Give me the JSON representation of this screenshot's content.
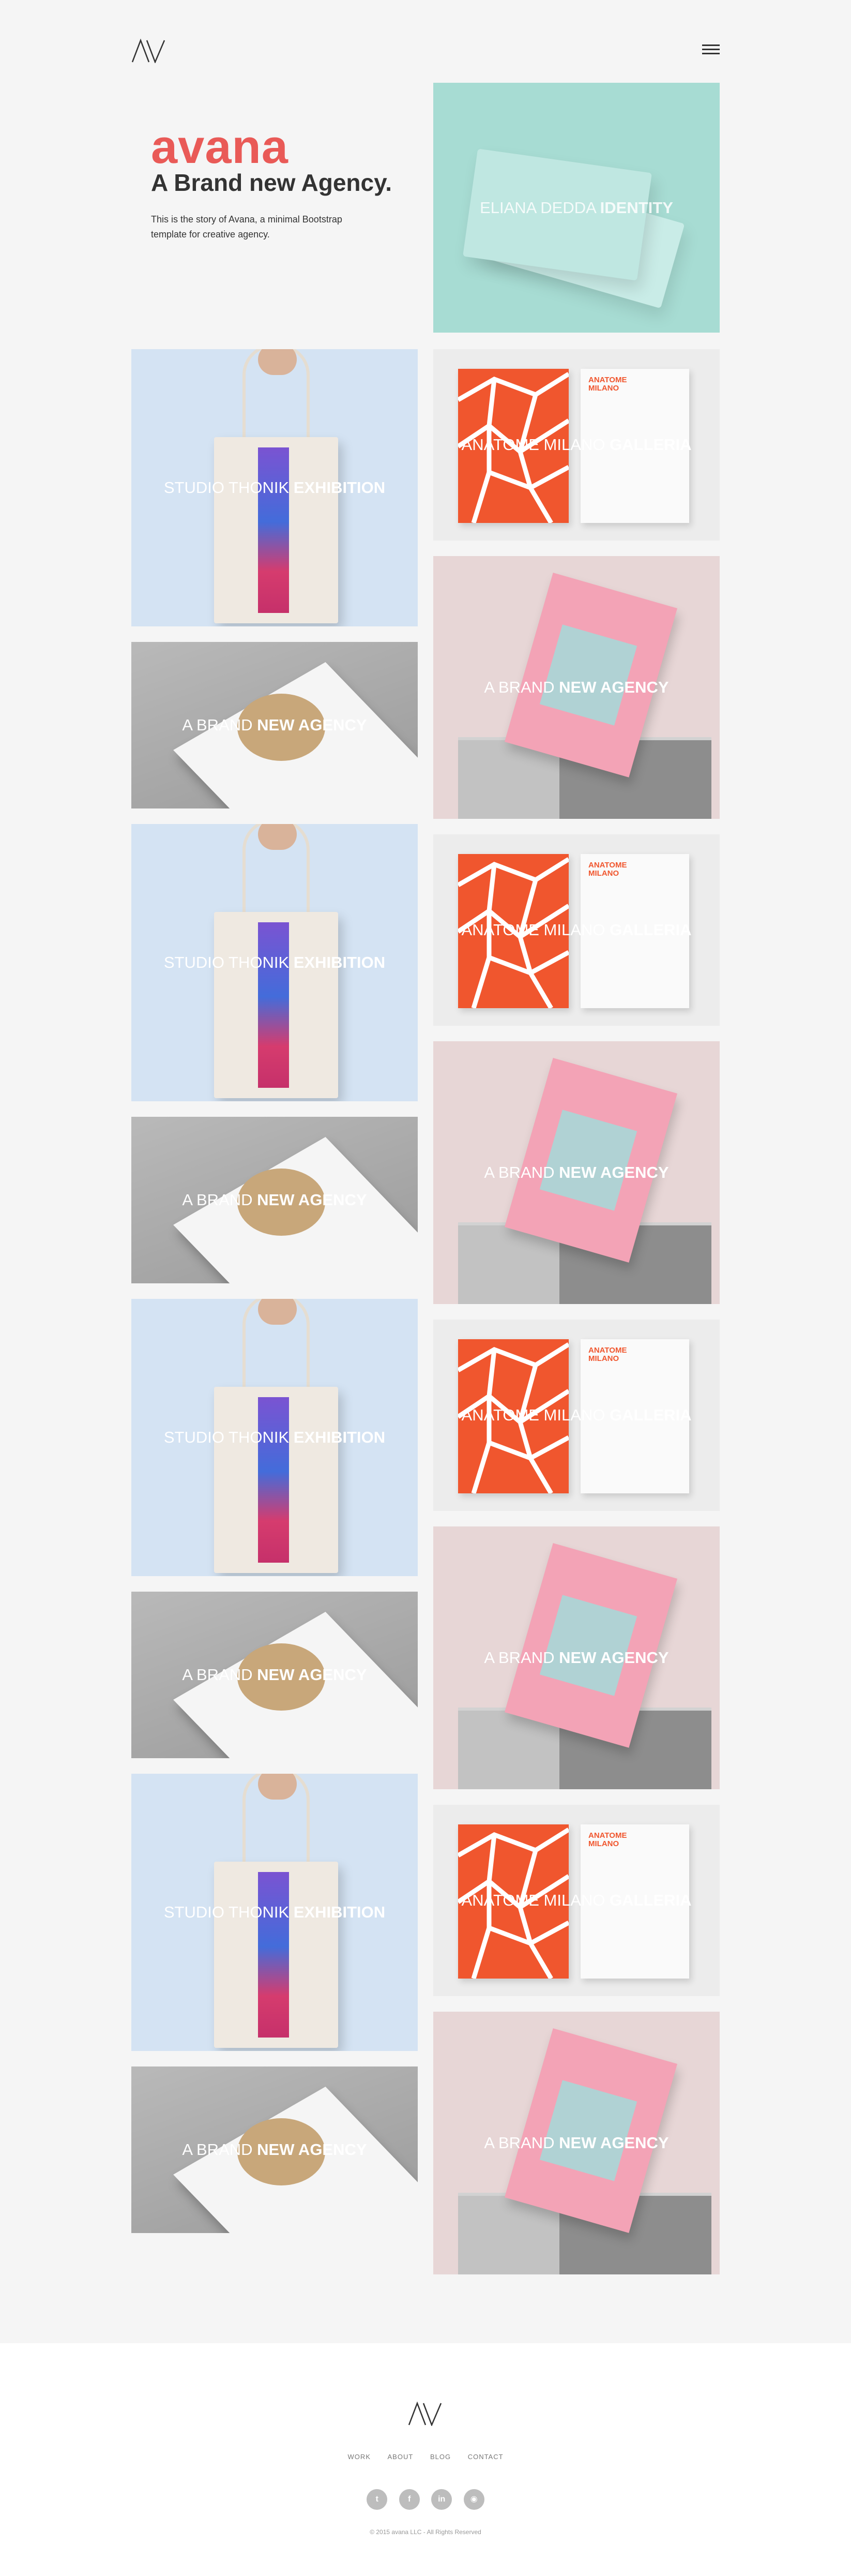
{
  "header": {
    "logo_text": "AV"
  },
  "intro": {
    "brand": "avana",
    "tagline": "A Brand new Agency.",
    "description": "This is the story of Avana, a minimal Bootstrap template for creative agency."
  },
  "tiles": {
    "mint_identity": {
      "light": "ELIANA DEDDA ",
      "bold": "IDENTITY"
    },
    "studio": {
      "light": "STUDIO THONIK ",
      "bold": "EXHIBITION"
    },
    "anatome": {
      "light": "ANATOME MILANO ",
      "bold": "GALLERIA"
    },
    "agency": {
      "light": "A BRAND ",
      "bold": "NEW AGENCY"
    }
  },
  "poster": {
    "title_line1": "ANATOME",
    "title_line2": "MILANO"
  },
  "footer": {
    "logo_text": "AV",
    "nav": [
      "WORK",
      "ABOUT",
      "BLOG",
      "CONTACT"
    ],
    "social": [
      "t",
      "f",
      "in",
      "◉"
    ],
    "copyright": "© 2015 avana LLC - All Rights Reserved"
  },
  "colors": {
    "accent": "#e95a57",
    "mint": "#a7dcd3",
    "blue": "#d4e3f3",
    "orange": "#f0562e",
    "pink": "#f3a3b6"
  }
}
